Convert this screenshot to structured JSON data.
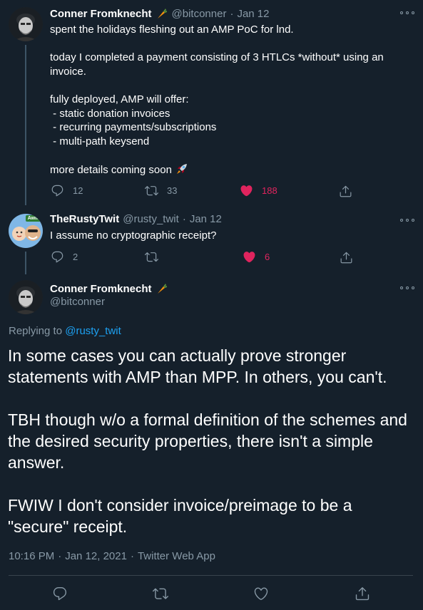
{
  "tweet1": {
    "name": "Conner Fromknecht",
    "handle": "@bitconner",
    "separator": "·",
    "date": "Jan 12",
    "text": "spent the holidays fleshing out an AMP PoC for lnd.\n\ntoday I completed a payment consisting of 3 HTLCs *without* using an invoice.\n\nfully deployed, AMP will offer:\n - static donation invoices\n - recurring payments/subscriptions\n - multi-path keysend\n\nmore details coming soon",
    "replies": "12",
    "retweets": "33",
    "likes": "188"
  },
  "tweet2": {
    "name": "TheRustyTwit",
    "handle": "@rusty_twit",
    "separator": "·",
    "date": "Jan 12",
    "text": "I assume no cryptographic receipt?",
    "replies": "2",
    "retweets": "",
    "likes": "6",
    "avatar_badge": "Awin"
  },
  "main": {
    "name": "Conner Fromknecht",
    "handle": "@bitconner",
    "replying_prefix": "Replying to ",
    "replying_to": "@rusty_twit",
    "text": "In some cases you can actually prove stronger statements with AMP than MPP. In others, you can't.\n\nTBH though w/o a formal definition of the schemes and the desired security properties, there isn't a simple answer.\n\nFWIW I don't consider invoice/preimage to be a \"secure\" receipt.",
    "time": "10:16 PM",
    "separator": "·",
    "date": "Jan 12, 2021",
    "source": "Twitter Web App"
  },
  "colors": {
    "background": "#15202b",
    "text": "#ffffff",
    "muted": "#8899a6",
    "link": "#1da1f2",
    "like": "#e0245e",
    "thread_line": "#3d5466",
    "divider": "#38444d"
  },
  "icons": [
    "reply-icon",
    "retweet-icon",
    "like-icon",
    "share-icon",
    "more-icon",
    "carrot-emoji",
    "rocket-emoji"
  ]
}
